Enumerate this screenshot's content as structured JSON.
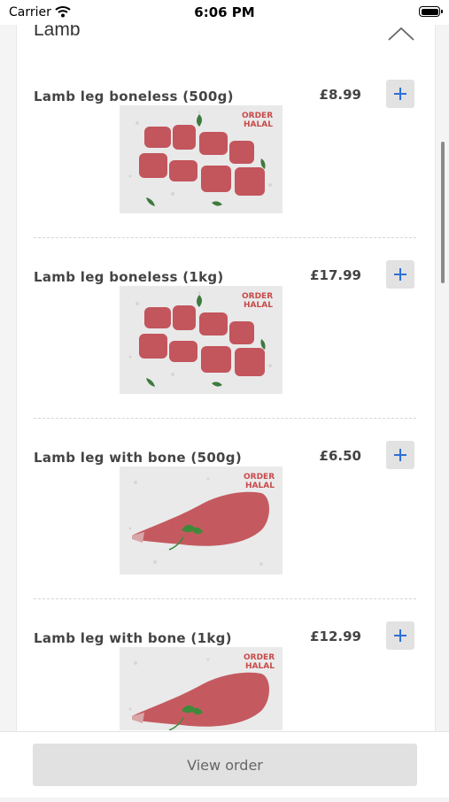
{
  "status_bar": {
    "carrier": "Carrier",
    "time": "6:06 PM"
  },
  "section": {
    "title": "Lamb",
    "toggle_icon": "chevron-up-icon"
  },
  "items": [
    {
      "name": "Lamb leg boneless (500g)",
      "price": "£8.99",
      "image": "diced-lamb-photo"
    },
    {
      "name": "Lamb leg boneless (1kg)",
      "price": "£17.99",
      "image": "diced-lamb-photo"
    },
    {
      "name": "Lamb leg with bone (500g)",
      "price": "£6.50",
      "image": "lamb-leg-photo"
    },
    {
      "name": "Lamb leg with bone (1kg)",
      "price": "£12.99",
      "image": "lamb-leg-photo"
    }
  ],
  "add_icon": "plus-icon",
  "accent_color": "#2e6fd6",
  "footer": {
    "view_order_label": "View order"
  }
}
